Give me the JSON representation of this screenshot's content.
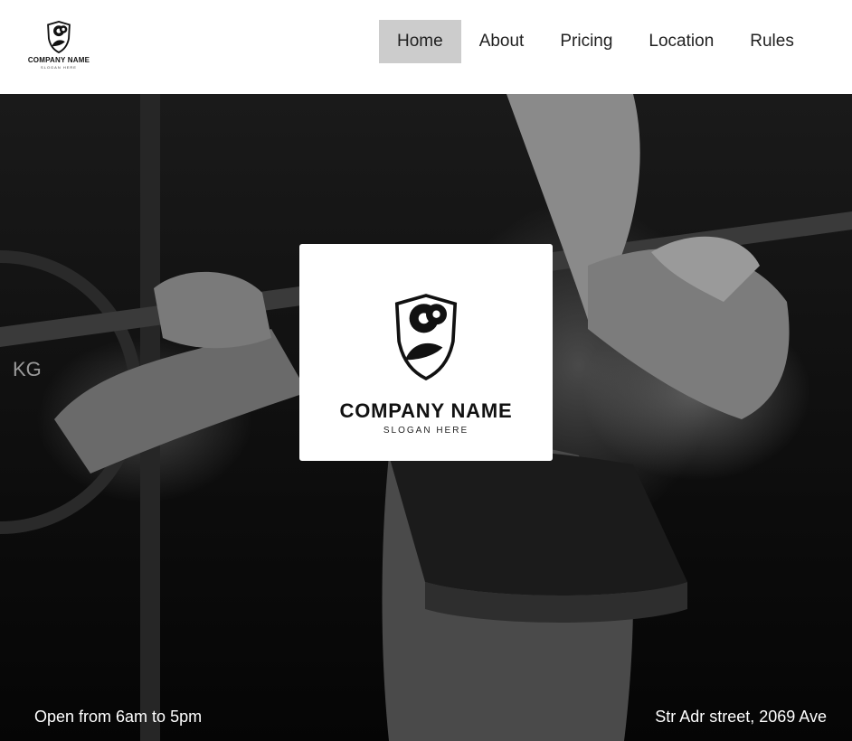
{
  "header": {
    "logo": {
      "name": "COMPANY NAME",
      "slogan": "SLOGAN HERE",
      "icon": "dumbbell-shield-icon"
    },
    "nav": [
      {
        "label": "Home",
        "active": true
      },
      {
        "label": "About",
        "active": false
      },
      {
        "label": "Pricing",
        "active": false
      },
      {
        "label": "Location",
        "active": false
      },
      {
        "label": "Rules",
        "active": false
      }
    ]
  },
  "hero": {
    "background": "black-and-white photo of a person lifting a barbell",
    "plate_text": "KG",
    "card": {
      "name": "COMPANY NAME",
      "slogan": "SLOGAN HERE",
      "icon": "dumbbell-shield-icon"
    },
    "hours": "Open from 6am to 5pm",
    "address": "Str Adr street, 2069 Ave"
  },
  "colors": {
    "nav_active_bg": "#cccccc",
    "header_bg": "#ffffff",
    "hero_bg": "#111111",
    "text_light": "#ffffff"
  }
}
